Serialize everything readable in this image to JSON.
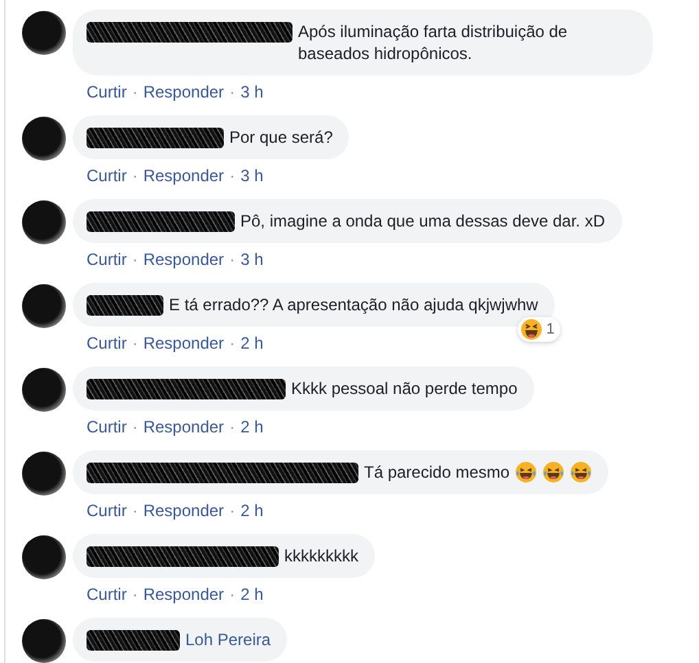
{
  "comments": [
    {
      "text": "Após iluminação farta distribuição de baseados hidropônicos.",
      "actions": [
        {
          "kind": "link",
          "text": "Curtir"
        },
        {
          "kind": "dot",
          "text": "·"
        },
        {
          "kind": "link",
          "text": "Responder"
        },
        {
          "kind": "dot",
          "text": "·"
        },
        {
          "kind": "time",
          "text": "3 h"
        }
      ]
    },
    {
      "text": "Por que será?",
      "actions": [
        {
          "kind": "link",
          "text": "Curtir"
        },
        {
          "kind": "dot",
          "text": "·"
        },
        {
          "kind": "link",
          "text": "Responder"
        },
        {
          "kind": "dot",
          "text": "·"
        },
        {
          "kind": "time",
          "text": "3 h"
        }
      ]
    },
    {
      "text": "Pô, imagine a onda que uma dessas deve dar. xD",
      "actions": [
        {
          "kind": "link",
          "text": "Curtir"
        },
        {
          "kind": "dot",
          "text": "·"
        },
        {
          "kind": "link",
          "text": "Responder"
        },
        {
          "kind": "dot",
          "text": "·"
        },
        {
          "kind": "time",
          "text": "3 h"
        }
      ]
    },
    {
      "text": "E tá errado?? A apresentação não ajuda qkjwjwhw",
      "reaction": {
        "kind": "haha",
        "count": "1"
      },
      "actions": [
        {
          "kind": "link",
          "text": "Curtir"
        },
        {
          "kind": "dot",
          "text": "·"
        },
        {
          "kind": "link",
          "text": "Responder"
        },
        {
          "kind": "dot",
          "text": "·"
        },
        {
          "kind": "time",
          "text": "2 h"
        }
      ]
    },
    {
      "text": "Kkkk pessoal não perde tempo",
      "actions": [
        {
          "kind": "link",
          "text": "Curtir"
        },
        {
          "kind": "dot",
          "text": "·"
        },
        {
          "kind": "link",
          "text": "Responder"
        },
        {
          "kind": "dot",
          "text": "·"
        },
        {
          "kind": "time",
          "text": "2 h"
        }
      ]
    },
    {
      "text": "Tá parecido mesmo",
      "emojis": [
        {
          "kind": "tears-of-joy"
        },
        {
          "kind": "tears-of-joy"
        },
        {
          "kind": "tears-of-joy"
        }
      ],
      "actions": [
        {
          "kind": "link",
          "text": "Curtir"
        },
        {
          "kind": "dot",
          "text": "·"
        },
        {
          "kind": "link",
          "text": "Responder"
        },
        {
          "kind": "dot",
          "text": "·"
        },
        {
          "kind": "time",
          "text": "2 h"
        }
      ]
    },
    {
      "text": "kkkkkkkkk",
      "actions": [
        {
          "kind": "link",
          "text": "Curtir"
        },
        {
          "kind": "dot",
          "text": "·"
        },
        {
          "kind": "link",
          "text": "Responder"
        },
        {
          "kind": "dot",
          "text": "·"
        },
        {
          "kind": "time",
          "text": "2 h"
        }
      ]
    },
    {
      "name": "Loh Pereira"
    }
  ]
}
